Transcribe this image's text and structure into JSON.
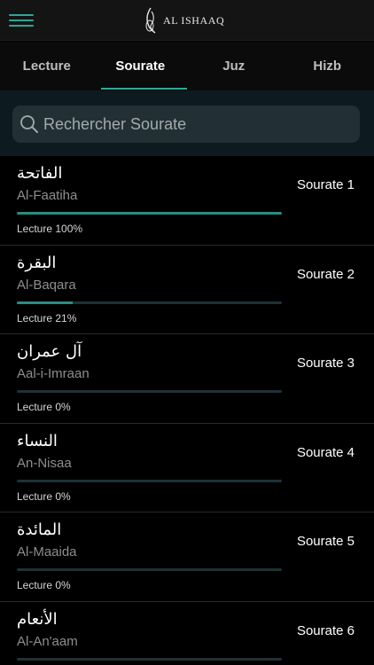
{
  "header": {
    "logo_text": "AL ISHAAQ"
  },
  "tabs": [
    {
      "label": "Lecture",
      "active": false
    },
    {
      "label": "Sourate",
      "active": true
    },
    {
      "label": "Juz",
      "active": false
    },
    {
      "label": "Hizb",
      "active": false
    }
  ],
  "search": {
    "placeholder": "Rechercher Sourate",
    "value": ""
  },
  "sourates": [
    {
      "arabic": "الفاتحة",
      "name": "Al-Faatiha",
      "progress_label": "Lecture 100%",
      "progress": 1.0,
      "number_label": "Sourate 1"
    },
    {
      "arabic": "البقرة",
      "name": "Al-Baqara",
      "progress_label": "Lecture 21%",
      "progress": 0.21,
      "number_label": "Sourate 2"
    },
    {
      "arabic": "آل عمران",
      "name": "Aal-i-Imraan",
      "progress_label": "Lecture 0%",
      "progress": 0.0,
      "number_label": "Sourate 3"
    },
    {
      "arabic": "النساء",
      "name": "An-Nisaa",
      "progress_label": "Lecture 0%",
      "progress": 0.0,
      "number_label": "Sourate 4"
    },
    {
      "arabic": "المائدة",
      "name": "Al-Maaida",
      "progress_label": "Lecture 0%",
      "progress": 0.0,
      "number_label": "Sourate 5"
    },
    {
      "arabic": "الأنعام",
      "name": "Al-An'aam",
      "progress_label": "",
      "progress": 0.0,
      "number_label": "Sourate 6"
    }
  ],
  "colors": {
    "accent": "#34a596",
    "progress_fill": "#2a8c83",
    "background": "#000000"
  }
}
